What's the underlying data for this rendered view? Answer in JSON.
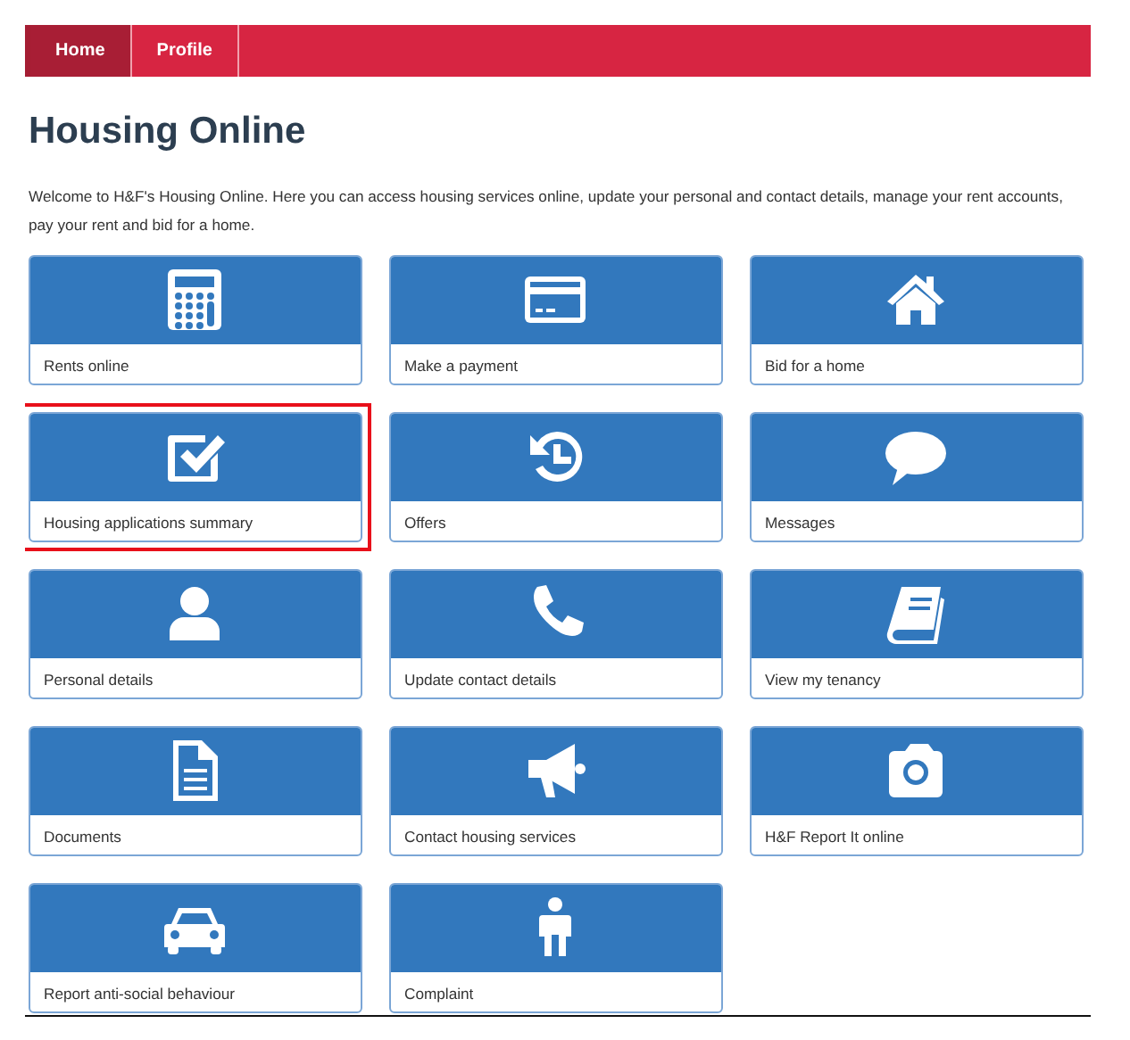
{
  "nav": [
    {
      "label": "Home",
      "selected": true
    },
    {
      "label": "Profile",
      "selected": false
    }
  ],
  "title": "Housing Online",
  "intro": "Welcome to H&F's Housing Online. Here you can access housing services online, update your personal and contact details, manage your rent accounts, pay your rent and bid for a home.",
  "tiles": [
    {
      "label": "Rents online",
      "kind": "calculator",
      "highlighted": false
    },
    {
      "label": "Make a payment",
      "kind": "card",
      "highlighted": false
    },
    {
      "label": "Bid for a home",
      "kind": "house",
      "highlighted": false
    },
    {
      "label": "Housing applications summary",
      "kind": "check",
      "highlighted": true
    },
    {
      "label": "Offers",
      "kind": "history",
      "highlighted": false
    },
    {
      "label": "Messages",
      "kind": "chat",
      "highlighted": false
    },
    {
      "label": "Personal details",
      "kind": "user",
      "highlighted": false
    },
    {
      "label": "Update contact details",
      "kind": "phone",
      "highlighted": false
    },
    {
      "label": "View my tenancy",
      "kind": "book",
      "highlighted": false
    },
    {
      "label": "Documents",
      "kind": "document",
      "highlighted": false
    },
    {
      "label": "Contact housing services",
      "kind": "megaphone",
      "highlighted": false
    },
    {
      "label": "H&F Report It online",
      "kind": "camera",
      "highlighted": false
    },
    {
      "label": "Report anti-social behaviour",
      "kind": "car",
      "highlighted": false
    },
    {
      "label": "Complaint",
      "kind": "figure",
      "highlighted": false
    }
  ]
}
